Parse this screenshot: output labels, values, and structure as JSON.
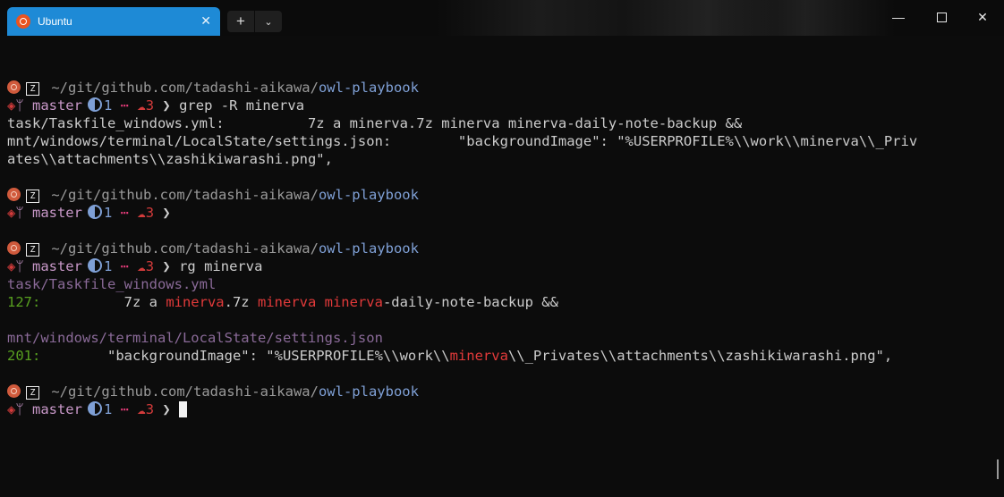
{
  "tab": {
    "title": "Ubuntu",
    "icon": "ubuntu-icon",
    "close_glyph": "✕"
  },
  "tab_controls": {
    "new_glyph": "+",
    "dropdown_glyph": "⌄"
  },
  "window": {
    "minimize": "—",
    "close": "✕"
  },
  "prompt": {
    "path_prefix": "~/git/github.com/tadashi-aikawa/",
    "repo": "owl-playbook",
    "branch": "master",
    "ahead": "1",
    "dots": "⋯",
    "cloud_count": "3",
    "chevron": "❯",
    "z_glyph": "Z",
    "cloud_glyph": "☁"
  },
  "commands": {
    "grep": "grep -R minerva",
    "rg": "rg minerva"
  },
  "grep_output": [
    "task/Taskfile_windows.yml:          7z a minerva.7z minerva minerva-daily-note-backup &&",
    "mnt/windows/terminal/LocalState/settings.json:        \"backgroundImage\": \"%USERPROFILE%\\\\work\\\\minerva\\\\_Priv",
    "ates\\\\attachments\\\\zashikiwarashi.png\","
  ],
  "rg_output": {
    "file1": "task/Taskfile_windows.yml",
    "file1_lineno": "127:",
    "file1_pre": "          7z a ",
    "file1_hit1": "minerva",
    "file1_mid1": ".7z ",
    "file1_hit2": "minerva",
    "file1_mid2": " ",
    "file1_hit3": "minerva",
    "file1_post": "-daily-note-backup &&",
    "file2": "mnt/windows/terminal/LocalState/settings.json",
    "file2_lineno": "201:",
    "file2_pre": "        \"backgroundImage\": \"%USERPROFILE%\\\\work\\\\",
    "file2_hit": "minerva",
    "file2_post": "\\\\_Privates\\\\attachments\\\\zashikiwarashi.png\","
  },
  "colors": {
    "tab_active": "#1e8ad6",
    "background": "#0c0c0c",
    "match": "#e23a3a",
    "line_number": "#58a020",
    "filename": "#8a6a98"
  }
}
